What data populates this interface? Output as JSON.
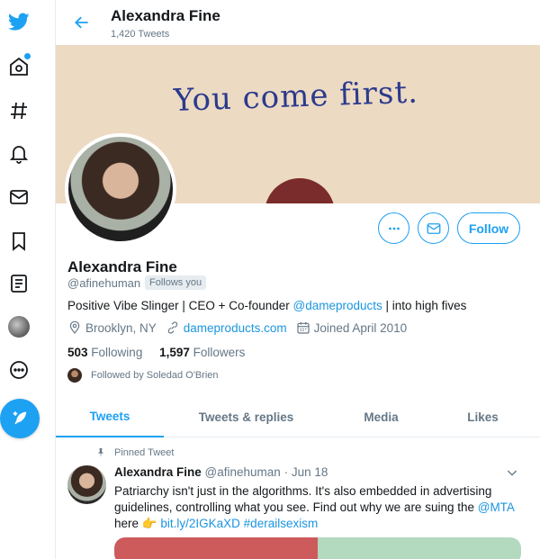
{
  "header": {
    "name": "Alexandra Fine",
    "tweet_count": "1,420 Tweets"
  },
  "banner": {
    "text": "You come first."
  },
  "profile": {
    "name": "Alexandra Fine",
    "handle": "@afinehuman",
    "follows_you": "Follows you",
    "bio_prefix": "Positive Vibe Slinger | CEO + Co-founder ",
    "bio_mention": "@dameproducts",
    "bio_suffix": " | into high fives",
    "location": "Brooklyn, NY",
    "website": "dameproducts.com",
    "joined": "Joined April 2010",
    "following_count": "503",
    "following_label": "Following",
    "followers_count": "1,597",
    "followers_label": "Followers",
    "followed_by": "Followed by Soledad O'Brien"
  },
  "actions": {
    "follow_label": "Follow"
  },
  "tabs": [
    {
      "label": "Tweets",
      "active": true
    },
    {
      "label": "Tweets & replies",
      "active": false
    },
    {
      "label": "Media",
      "active": false
    },
    {
      "label": "Likes",
      "active": false
    }
  ],
  "tweet": {
    "pinned_label": "Pinned Tweet",
    "author": "Alexandra Fine",
    "handle": "@afinehuman",
    "sep": " · ",
    "date": "Jun 18",
    "text_1": "Patriarchy isn't just in the algorithms. It's also embedded in advertising guidelines, controlling what you see. Find out why we are suing the ",
    "mention": "@MTA",
    "text_2": " here ",
    "emoji": "👉",
    "link": "bit.ly/2IGKaXD",
    "hashtag": "#derailsexism"
  },
  "colors": {
    "accent": "#1da1f2",
    "text": "#14171a",
    "muted": "#657786",
    "banner_bg": "#ecdac3",
    "banner_text": "#2b3a8c"
  }
}
